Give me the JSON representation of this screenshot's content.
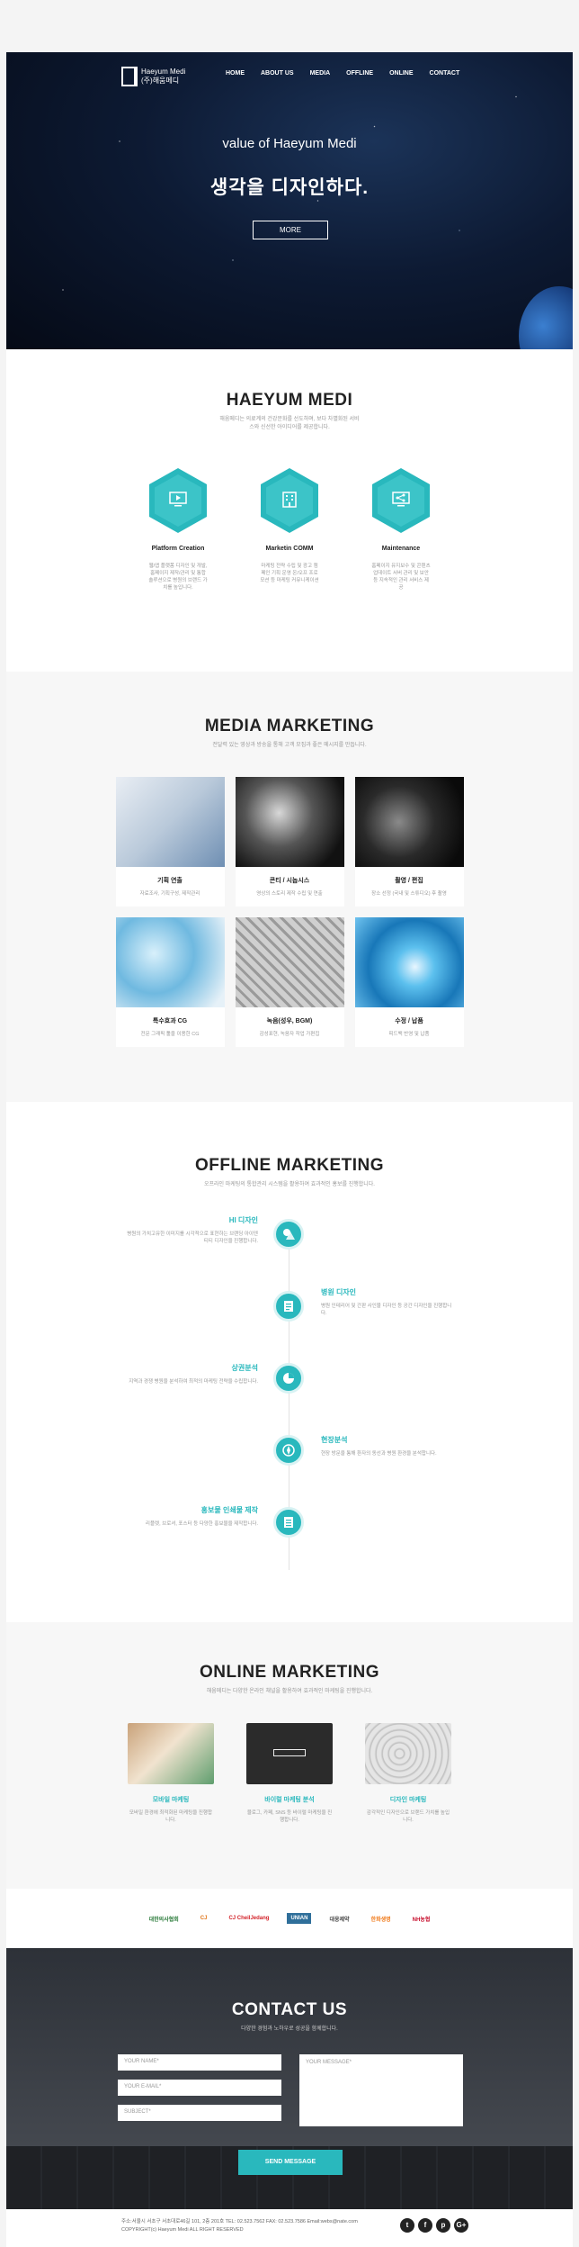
{
  "nav": {
    "logo_line1": "Haeyum Medi",
    "logo_line2": "(주)해움메디",
    "items": [
      "HOME",
      "ABOUT US",
      "MEDIA",
      "OFFLINE",
      "ONLINE",
      "CONTACT"
    ]
  },
  "hero": {
    "subtitle": "value of Haeyum Medi",
    "title": "생각을 디자인하다.",
    "button": "MORE"
  },
  "about": {
    "title": "HAEYUM MEDI",
    "desc": "해움메디는 의료계의 건강문화를 선도하며, 보다 차별화된 서비스와 신선한 아이디어를 제공합니다.",
    "services": [
      {
        "title": "Platform Creation",
        "desc": "웹/앱 플랫폼 디자인 및 개발, 홈페이지 제작/관리 및 통합 솔루션으로 병원의 브랜드 가치를 높입니다.",
        "icon": "monitor-play-icon"
      },
      {
        "title": "Marketin COMM",
        "desc": "마케팅 전략 수립 및 광고 캠페인 기획 운영 온/오프 프로모션 등 마케팅 커뮤니케이션",
        "icon": "building-icon"
      },
      {
        "title": "Maintenance",
        "desc": "홈페이지 유지보수 및 콘텐츠 업데이트 서버 관리 및 보안 등 지속적인 관리 서비스 제공",
        "icon": "share-icon"
      }
    ]
  },
  "media": {
    "title": "MEDIA MARKETING",
    "desc": "전달력 있는 영상과 방송을 통해 고객 모집과 좋은 메시지를 만듭니다.",
    "cards": [
      {
        "title": "기획 연출",
        "desc": "자료조사, 기획구성, 제작관리"
      },
      {
        "title": "콘티 / 시놉시스",
        "desc": "영상의 스토리 제작 수립 및 연출"
      },
      {
        "title": "촬영 / 편집",
        "desc": "장소 선정 (국내 및 스튜디오) 후 촬영"
      },
      {
        "title": "특수효과 CG",
        "desc": "전문 그래픽 툴을 이용한 CG"
      },
      {
        "title": "녹음(성우, BGM)",
        "desc": "감성표현, 녹음자 작업 가편집"
      },
      {
        "title": "수정 / 납품",
        "desc": "피드백 반영 및 납품"
      }
    ]
  },
  "offline": {
    "title": "OFFLINE MARKETING",
    "desc": "오프라인 마케팅의 통합관리 시스템을 활용하여 효과적인 홍보를 진행합니다.",
    "items": [
      {
        "title": "HI 디자인",
        "desc": "병원의 가치고유한 이미지를 시각적으로 표현하는 브랜딩 아이덴티티 디자인을 진행합니다.",
        "side": "left",
        "icon": "shapes-icon"
      },
      {
        "title": "병원 디자인",
        "desc": "병원 인테리어 및 간판 사인물 디자인 등 공간 디자인을 진행합니다.",
        "side": "right",
        "icon": "document-icon"
      },
      {
        "title": "상권분석",
        "desc": "지역과 경쟁 병원을 분석하여 최적의 마케팅 전략을 수립합니다.",
        "side": "left",
        "icon": "pie-chart-icon"
      },
      {
        "title": "현장분석",
        "desc": "현장 방문을 통해 환자의 동선과 병원 환경을 분석합니다.",
        "side": "right",
        "icon": "compass-icon"
      },
      {
        "title": "홍보물 인쇄물 제작",
        "desc": "리플렛, 브로셔, 포스터 등 다양한 홍보물을 제작합니다.",
        "side": "left",
        "icon": "book-icon"
      }
    ]
  },
  "online": {
    "title": "ONLINE MARKETING",
    "desc": "해움메디는 다양한 온라인 채널을 활용하여 효과적인 마케팅을 진행합니다.",
    "items": [
      {
        "title": "모바일 마케팅",
        "desc": "모바일 환경에 최적화된 마케팅을 진행합니다."
      },
      {
        "title": "바이럴 마케팅 분석",
        "desc": "블로그, 카페, SNS 등 바이럴 마케팅을 진행합니다."
      },
      {
        "title": "디자인 마케팅",
        "desc": "감각적인 디자인으로 브랜드 가치를 높입니다."
      }
    ]
  },
  "partners": [
    "대한의사협회",
    "CJ",
    "CJ CheilJedang",
    "UNIAN",
    "대웅제약",
    "한화생명",
    "NH농협"
  ],
  "contact": {
    "title": "CONTACT US",
    "desc": "다양한 경험과 노하우로 성공을 함께합니다.",
    "name_placeholder": "YOUR NAME*",
    "email_placeholder": "YOUR E-MAIL*",
    "subject_placeholder": "SUBJECT*",
    "message_placeholder": "YOUR MESSAGE*",
    "send": "SEND MESSAGE"
  },
  "footer": {
    "address": "주소:서울시 서초구 서초대로46길 101, 2층 201호 TEL: 02.523.7562 FAX: 02.523.7586 Email:webs@nate.com",
    "copyright": "COPYRIGHT(c) Haeyum Medi ALL RIGHT RESERVED",
    "social": [
      "t",
      "f",
      "p",
      "G+"
    ]
  },
  "colors": {
    "accent": "#29b8bd",
    "dark": "#2d3138"
  }
}
